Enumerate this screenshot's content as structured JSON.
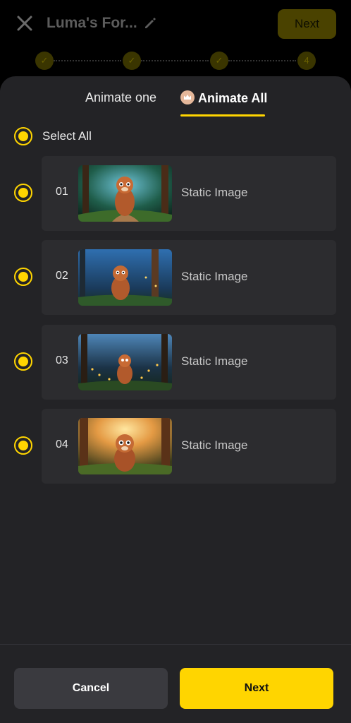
{
  "header": {
    "title": "Luma's For...",
    "next_label": "Next",
    "steps": [
      "",
      "",
      "",
      "4"
    ]
  },
  "tabs": {
    "animate_one": "Animate one",
    "animate_all": "Animate All"
  },
  "select_all_label": "Select All",
  "items": [
    {
      "number": "01",
      "status": "Static Image"
    },
    {
      "number": "02",
      "status": "Static Image"
    },
    {
      "number": "03",
      "status": "Static Image"
    },
    {
      "number": "04",
      "status": "Static Image"
    }
  ],
  "footer": {
    "cancel_label": "Cancel",
    "next_label": "Next"
  },
  "colors": {
    "accent": "#ffd500",
    "sheet_bg": "#232326",
    "card_bg": "#2c2c2f"
  }
}
